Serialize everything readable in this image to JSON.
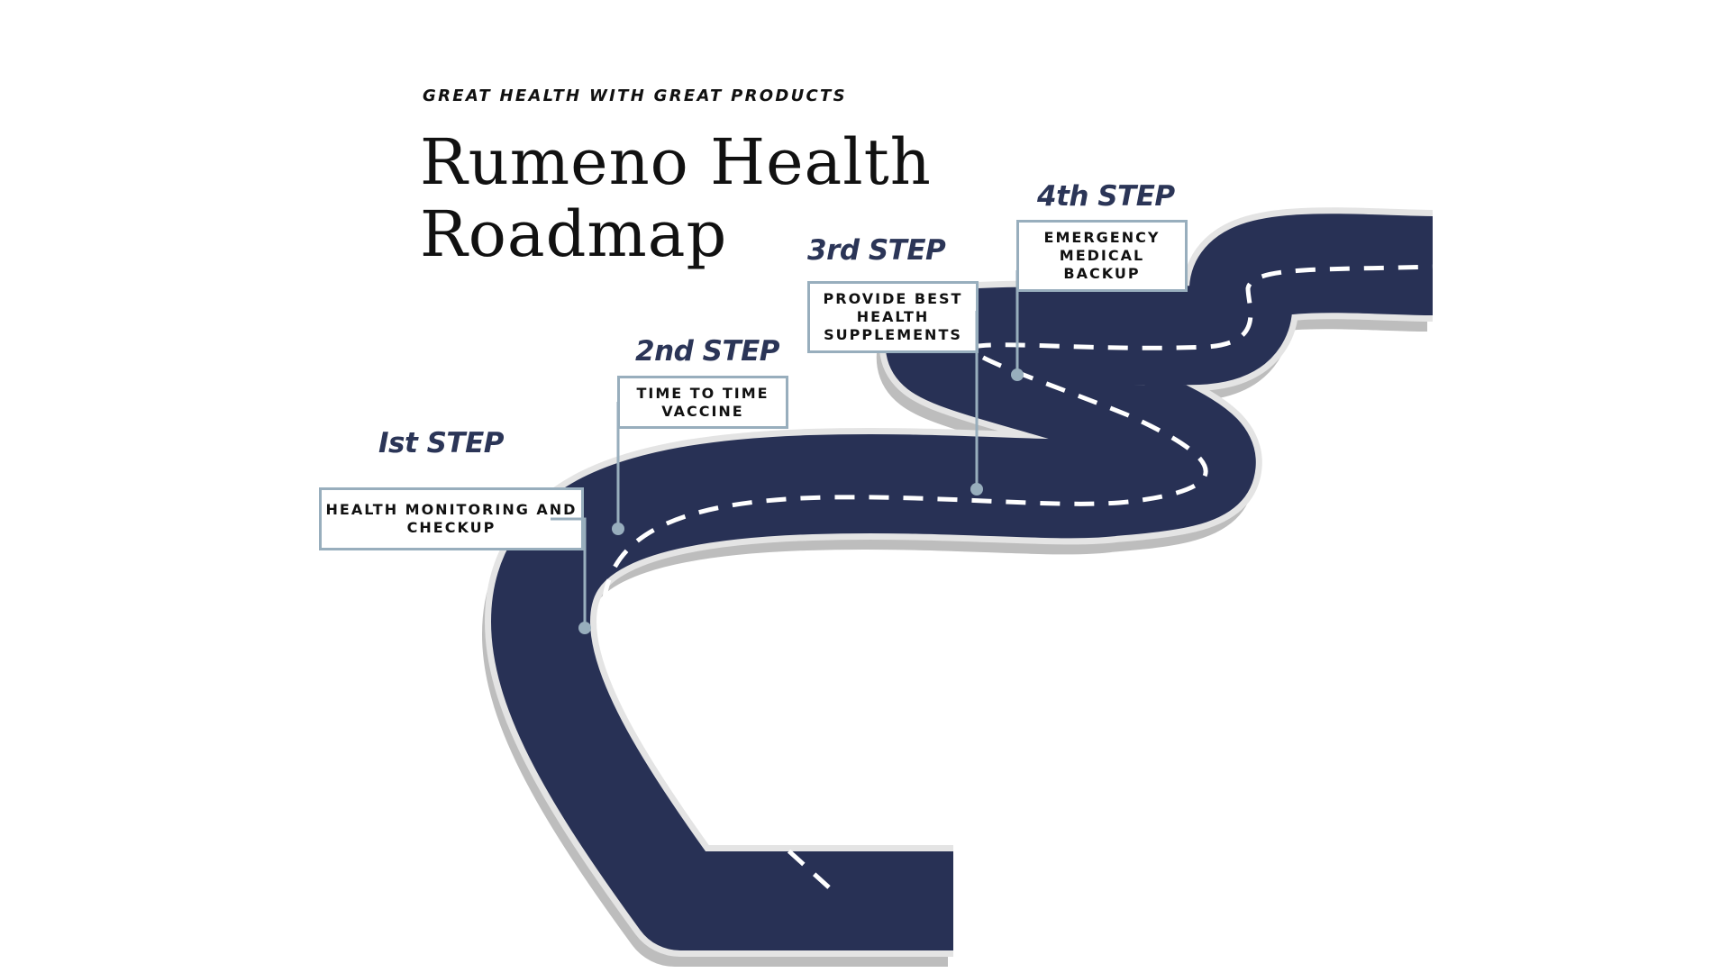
{
  "header": {
    "tagline": "GREAT HEALTH WITH GREAT PRODUCTS",
    "title_line1": "Rumeno Health",
    "title_line2": "Roadmap"
  },
  "steps": [
    {
      "heading": "Ist STEP",
      "text": "HEALTH MONITORING AND CHECKUP"
    },
    {
      "heading": "2nd STEP",
      "text": "TIME TO TIME VACCINE"
    },
    {
      "heading": "3rd STEP",
      "text": "PROVIDE BEST HEALTH SUPPLEMENTS"
    },
    {
      "heading": "4th STEP",
      "text": "EMERGENCY MEDICAL BACKUP"
    }
  ],
  "colors": {
    "road": "#283155",
    "road_edge": "#e4e4e4",
    "road_shadow": "#bdbdbd",
    "connector": "#98aebd",
    "heading_text": "#2b3557",
    "lane_marking": "#ffffff"
  }
}
